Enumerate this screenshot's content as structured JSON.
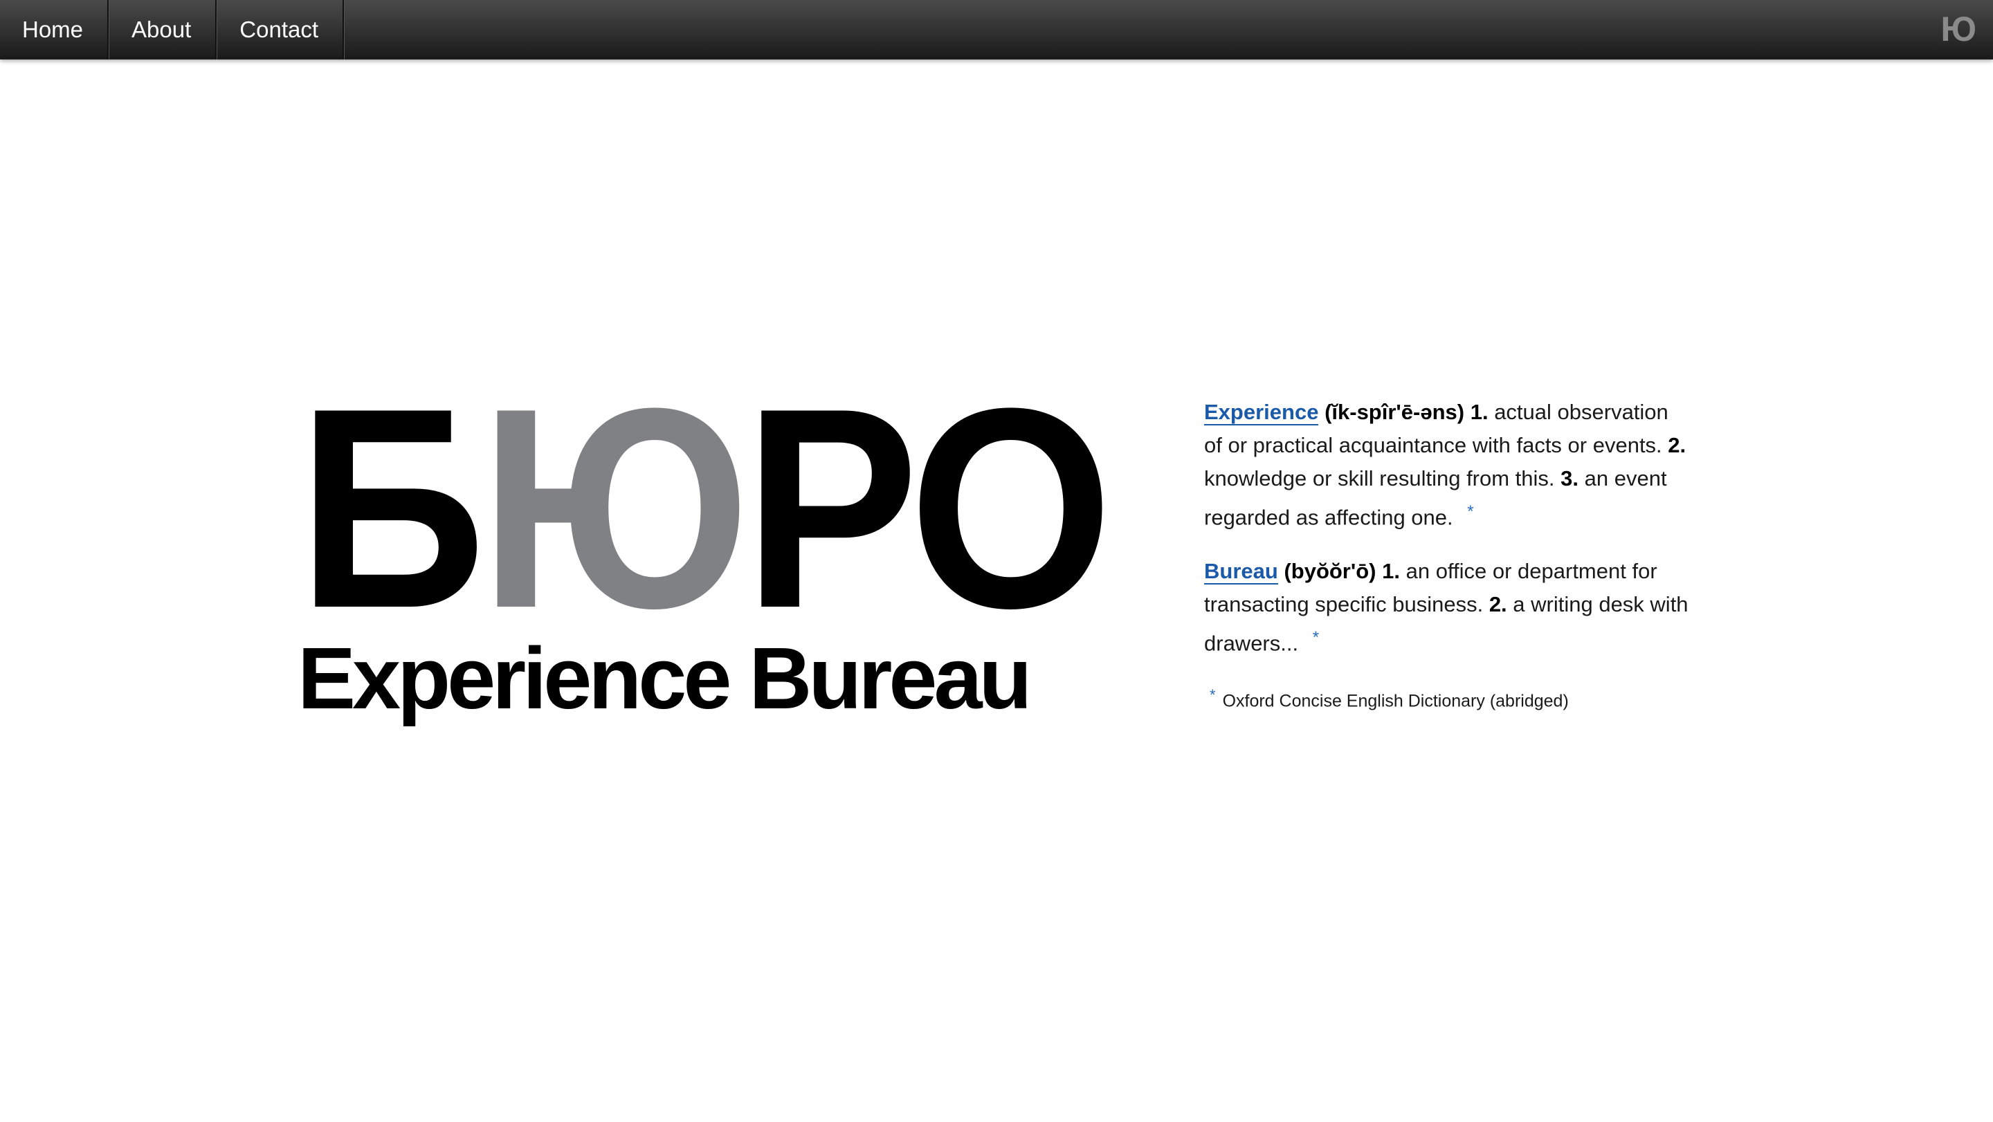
{
  "nav": {
    "items": [
      {
        "label": "Home"
      },
      {
        "label": "About"
      },
      {
        "label": "Contact"
      }
    ],
    "logo": "Ю"
  },
  "brand": {
    "mark_part1": "Б",
    "mark_part2": "Ю",
    "mark_part3": "РО",
    "name": "Experience Bureau",
    "colors": {
      "black": "#000000",
      "gray": "#808184"
    }
  },
  "definitions": {
    "experience": {
      "term": "Experience",
      "pronunciation": "(ĭk-spîr'ē-əns)",
      "n1": "1.",
      "d1": " actual observation of or practical acquaintance with facts or events. ",
      "n2": "2.",
      "d2": " knowledge or skill resulting from this. ",
      "n3": "3.",
      "d3": " an event regarded as affecting one.",
      "star": "*"
    },
    "bureau": {
      "term": "Bureau",
      "pronunciation": "(byŏŏr'ō)",
      "n1": "1.",
      "d1": " an office or department for transacting specific business. ",
      "n2": "2.",
      "d2": " a writing desk with drawers...",
      "star": "*"
    },
    "footnote": {
      "star": "*",
      "text": "Oxford Concise English Dictionary (abridged)"
    },
    "accent_color": "#1a5aa8"
  }
}
